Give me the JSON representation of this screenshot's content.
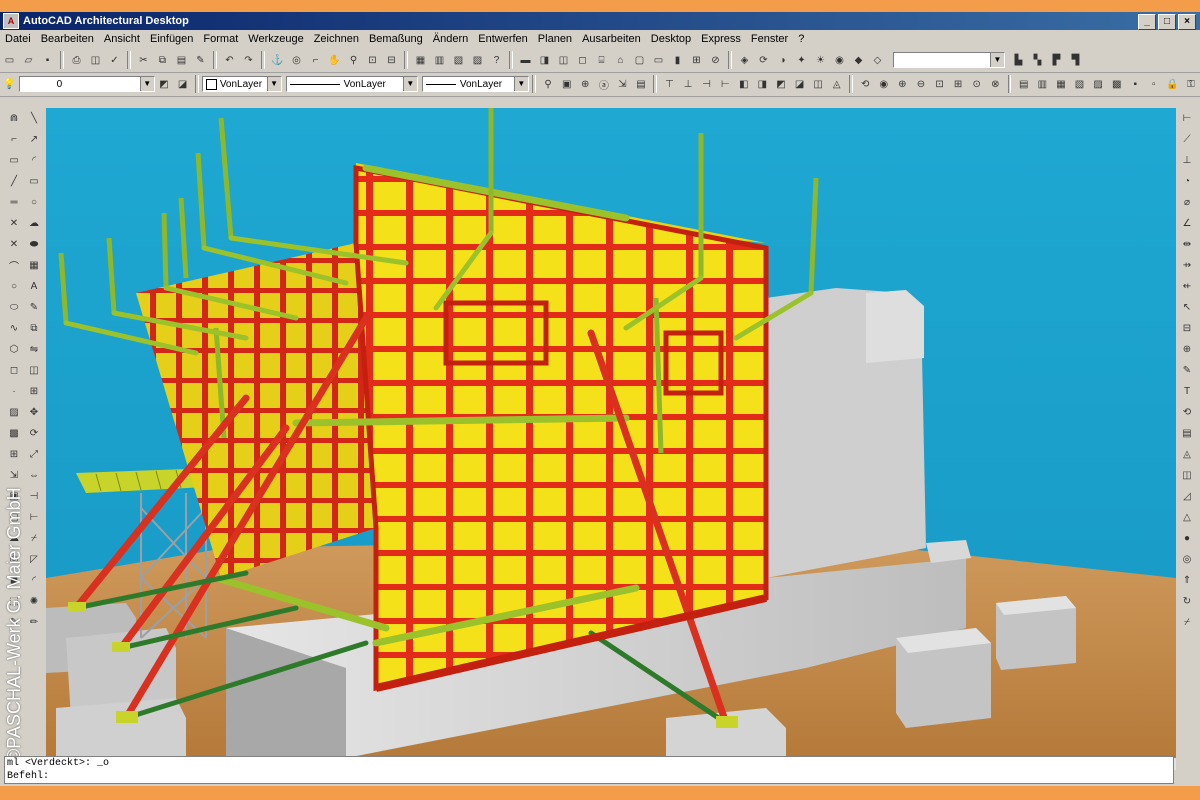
{
  "window": {
    "title": "AutoCAD Architectural Desktop",
    "buttons": [
      "_",
      "□",
      "×"
    ]
  },
  "menu": [
    "Datei",
    "Bearbeiten",
    "Ansicht",
    "Einfügen",
    "Format",
    "Werkzeuge",
    "Zeichnen",
    "Bemaßung",
    "Ändern",
    "Entwerfen",
    "Planen",
    "Ausarbeiten",
    "Desktop",
    "Express",
    "Fenster",
    "?"
  ],
  "layer_toolbar": {
    "layer_value": "0",
    "color_value": "VonLayer",
    "linetype_value": "VonLayer",
    "lineweight_value": "VonLayer"
  },
  "command": {
    "line1": "ml <Verdeckt>: _o",
    "line2": "Befehl:"
  },
  "watermark": "©PASCHAL-Werk G. Maier GmbH",
  "colors": {
    "accent_orange": "#f39c4a",
    "sky": "#1aa4cf",
    "formwork_red": "#e32b1a",
    "panel_yellow": "#f4e11a",
    "brace_green": "#9bc22a"
  }
}
